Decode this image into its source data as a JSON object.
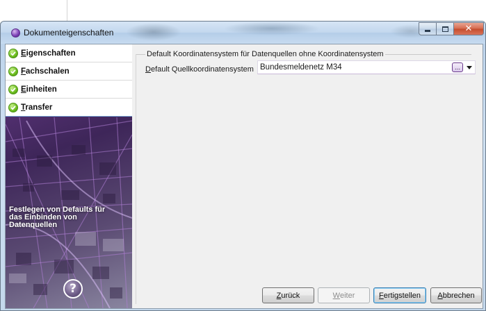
{
  "window": {
    "title": "Dokumenteigenschaften",
    "icon": "purple-globe-icon"
  },
  "nav": {
    "items": [
      {
        "prefix": "E",
        "rest": "igenschaften",
        "status": "done",
        "active": false
      },
      {
        "prefix": "F",
        "rest": "achschalen",
        "status": "done",
        "active": false
      },
      {
        "prefix": "E",
        "rest": "inheiten",
        "status": "done",
        "active": false
      },
      {
        "prefix": "T",
        "rest": "ransfer",
        "status": "done",
        "active": true
      }
    ],
    "description": "Festlegen von Defaults für\ndas Einbinden von\nDatenquellen",
    "help_label": "?"
  },
  "panel": {
    "group_caption": "Default Koordinatensystem für Datenquellen ohne Koordinatensystem",
    "field_label_prefix": "D",
    "field_label_rest": "efault Quellkoordinatensystem",
    "coord_value": "Bundesmeldenetz M34",
    "dots_label": "..."
  },
  "buttons": {
    "back_prefix": "Z",
    "back_rest": "urück",
    "next_prefix": "W",
    "next_rest": "eiter",
    "finish_prefix": "F",
    "finish_rest": "ertigstellen",
    "cancel_prefix": "A",
    "cancel_rest": "bbrechen"
  },
  "colors": {
    "accent": "#6a3a8c",
    "check_green": "#6dbd1f",
    "title_bar": "#c2d7ee",
    "close_red": "#c44b2b"
  }
}
